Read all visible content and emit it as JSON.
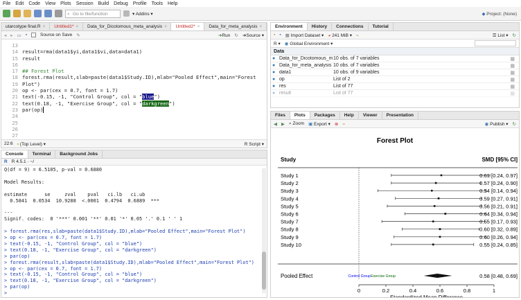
{
  "menu": [
    "File",
    "Edit",
    "Code",
    "View",
    "Plots",
    "Session",
    "Build",
    "Debug",
    "Profile",
    "Tools",
    "Help"
  ],
  "toolbar": {
    "goto_placeholder": "Go to file/function",
    "addins": "Addins",
    "project": "Project: (None)"
  },
  "editor": {
    "tabs": [
      {
        "label": "utarcotype final.R",
        "unsaved": false
      },
      {
        "label": "Untitled1*",
        "unsaved": true
      },
      {
        "label": "Data_for_Dicotomous_meta_analysis",
        "unsaved": false
      },
      {
        "label": "Untitled2*",
        "unsaved": true
      },
      {
        "label": "Data_for_meta_analysis",
        "unsaved": false
      }
    ],
    "source_on_save": "Source on Save",
    "run": "Run",
    "source": "Source",
    "lines": [
      {
        "n": "13",
        "t": ""
      },
      {
        "n": "14",
        "t": "result=rma(data1$yi,data1$vi,data=data1)"
      },
      {
        "n": "15",
        "t": "result"
      },
      {
        "n": "16",
        "t": ""
      },
      {
        "n": "17",
        "t": "## Forest Plot"
      },
      {
        "n": "18",
        "t": "forest.rma(result,slab=paste(data1$Study.ID),mlab=\"Pooled Effect\",main=\"Forest Plot\")"
      },
      {
        "n": "19",
        "t": "op <- par(cex = 0.7, font = 1.7)"
      },
      {
        "n": "20a",
        "t": "text(-0.15, -1, \"Control Group\", col = \""
      },
      {
        "n": "20b",
        "t": "blue"
      },
      {
        "n": "20c",
        "t": "\")"
      },
      {
        "n": "21a",
        "t": "text(0.18, -1, \"Exercise Group\", col = \""
      },
      {
        "n": "21b",
        "t": "darkgreen"
      },
      {
        "n": "21c",
        "t": "\")"
      },
      {
        "n": "22",
        "t": "par(op)"
      },
      {
        "n": "23",
        "t": ""
      },
      {
        "n": "24",
        "t": ""
      },
      {
        "n": "25",
        "t": ""
      },
      {
        "n": "26",
        "t": ""
      },
      {
        "n": "27",
        "t": ""
      }
    ],
    "linenums": [
      "13",
      "14",
      "15",
      "16",
      "17",
      "18",
      "19",
      "20",
      "21",
      "22",
      "23",
      "24",
      "25",
      "26",
      "27"
    ],
    "status_pos": "22:6",
    "status_level": "(Top Level)",
    "status_type": "R Script"
  },
  "console": {
    "tabs": [
      "Console",
      "Terminal",
      "Background Jobs"
    ],
    "path": "R 4.5.1 · ~/",
    "lines": [
      {
        "c": "out",
        "t": "Q(df = 9) = 6.5105, p-val = 0.6880"
      },
      {
        "c": "out",
        "t": ""
      },
      {
        "c": "out",
        "t": "Model Results:"
      },
      {
        "c": "out",
        "t": ""
      },
      {
        "c": "out",
        "t": "estimate      se     zval    pval   ci.lb   ci.ub"
      },
      {
        "c": "out",
        "t": "  0.5841  0.0534  10.9288  <.0001  0.4794  0.6889  ***"
      },
      {
        "c": "out",
        "t": ""
      },
      {
        "c": "out",
        "t": "---"
      },
      {
        "c": "out",
        "t": "Signif. codes:  0 '***' 0.001 '**' 0.01 '*' 0.05 '.' 0.1 ' ' 1"
      },
      {
        "c": "out",
        "t": ""
      },
      {
        "c": "cmd",
        "t": "> forest.rma(res,slab=paste(data1$Study.ID),mlab=\"Pooled Effect\",main=\"Forest Plot\")"
      },
      {
        "c": "cmd",
        "t": "> op <- par(cex = 0.7, font = 1.7)"
      },
      {
        "c": "cmd",
        "t": "> text(-0.15, -1, \"Control Group\", col = \"blue\")"
      },
      {
        "c": "cmd",
        "t": "> text(0.18, -1, \"Exercise Group\", col = \"darkgreen\")"
      },
      {
        "c": "cmd",
        "t": "> par(op)"
      },
      {
        "c": "cmd",
        "t": "> forest.rma(result,slab=paste(data1$Study.ID),mlab=\"Pooled Effect\",main=\"Forest Plot\")"
      },
      {
        "c": "cmd",
        "t": "> op <- par(cex = 0.7, font = 1.7)"
      },
      {
        "c": "cmd",
        "t": "> text(-0.15, -1, \"Control Group\", col = \"blue\")"
      },
      {
        "c": "cmd",
        "t": "> text(0.18, -1, \"Exercise Group\", col = \"darkgreen\")"
      },
      {
        "c": "cmd",
        "t": "> par(op)"
      },
      {
        "c": "cmd",
        "t": ">"
      }
    ]
  },
  "environment": {
    "tabs": [
      "Environment",
      "History",
      "Connections",
      "Tutorial"
    ],
    "import": "Import Dataset",
    "memory": "241 MiB",
    "list": "List",
    "r_label": "R",
    "global": "Global Environment",
    "section": "Data",
    "rows": [
      {
        "name": "Data_for_Dicotomous_m…",
        "value": "10 obs. of 7 variables"
      },
      {
        "name": "Data_for_meta_analysis",
        "value": "10 obs. of 7 variables"
      },
      {
        "name": "data1",
        "value": "10 obs. of 9 variables"
      },
      {
        "name": "op",
        "value": "List of 2"
      },
      {
        "name": "res",
        "value": "List of 77"
      },
      {
        "name": "result",
        "value": "List of 77"
      }
    ]
  },
  "plots": {
    "tabs": [
      "Files",
      "Plots",
      "Packages",
      "Help",
      "Viewer",
      "Presentation"
    ],
    "zoom": "Zoom",
    "export": "Export",
    "publish": "Publish"
  },
  "chart_data": {
    "type": "forest",
    "title": "Forest Plot",
    "left_header": "Study",
    "right_header": "SMD [95% CI]",
    "xlabel": "Standardized Mean Difference",
    "xlim": [
      0,
      1
    ],
    "ticks": [
      "0",
      "0.2",
      "0.4",
      "0.6",
      "0.8",
      "1"
    ],
    "tick_values": [
      0,
      0.2,
      0.4,
      0.6,
      0.8,
      1
    ],
    "studies": [
      {
        "label": "Study 1",
        "est": 0.61,
        "lo": 0.24,
        "hi": 0.97,
        "text": "0.61 [0.24, 0.97]"
      },
      {
        "label": "Study 2",
        "est": 0.57,
        "lo": 0.24,
        "hi": 0.9,
        "text": "0.57 [0.24, 0.90]"
      },
      {
        "label": "Study 3",
        "est": 0.54,
        "lo": 0.14,
        "hi": 0.94,
        "text": "0.54 [0.14, 0.94]"
      },
      {
        "label": "Study 4",
        "est": 0.59,
        "lo": 0.27,
        "hi": 0.91,
        "text": "0.59 [0.27, 0.91]"
      },
      {
        "label": "Study 5",
        "est": 0.56,
        "lo": 0.21,
        "hi": 0.91,
        "text": "0.56 [0.21, 0.91]"
      },
      {
        "label": "Study 6",
        "est": 0.64,
        "lo": 0.34,
        "hi": 0.94,
        "text": "0.64 [0.34, 0.94]"
      },
      {
        "label": "Study 7",
        "est": 0.55,
        "lo": 0.17,
        "hi": 0.93,
        "text": "0.55 [0.17, 0.93]"
      },
      {
        "label": "Study 8",
        "est": 0.6,
        "lo": 0.32,
        "hi": 0.89,
        "text": "0.60 [0.32, 0.89]"
      },
      {
        "label": "Study 9",
        "est": 0.6,
        "lo": 0.26,
        "hi": 0.94,
        "text": "0.60 [0.26, 0.94]"
      },
      {
        "label": "Study 10",
        "est": 0.55,
        "lo": 0.24,
        "hi": 0.85,
        "text": "0.55 [0.24, 0.85]"
      }
    ],
    "pooled": {
      "label": "Pooled Effect",
      "est": 0.58,
      "lo": 0.48,
      "hi": 0.69,
      "text": "0.58 [0.48, 0.69]"
    },
    "annotations": [
      {
        "text": "Control Group",
        "color": "#0000ff"
      },
      {
        "text": "Exercise Group",
        "color": "#006400"
      }
    ]
  }
}
